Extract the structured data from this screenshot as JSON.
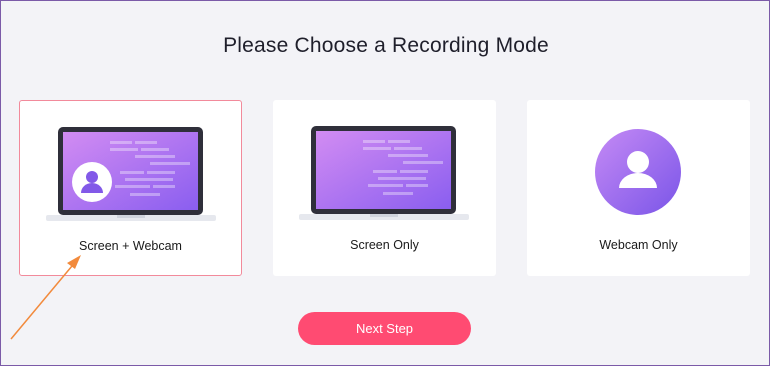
{
  "page": {
    "title": "Please Choose a Recording Mode"
  },
  "modes": [
    {
      "label": "Screen + Webcam",
      "selected": true,
      "icon": "laptop-webcam-icon"
    },
    {
      "label": "Screen Only",
      "selected": false,
      "icon": "laptop-icon"
    },
    {
      "label": "Webcam Only",
      "selected": false,
      "icon": "user-avatar-icon"
    }
  ],
  "next_button": {
    "label": "Next Step"
  },
  "colors": {
    "accent": "#ff4b72",
    "selected_border": "#f28a9b",
    "purple_start": "#c58af5",
    "purple_end": "#7a55e8",
    "annotation_arrow": "#f28a3c"
  }
}
